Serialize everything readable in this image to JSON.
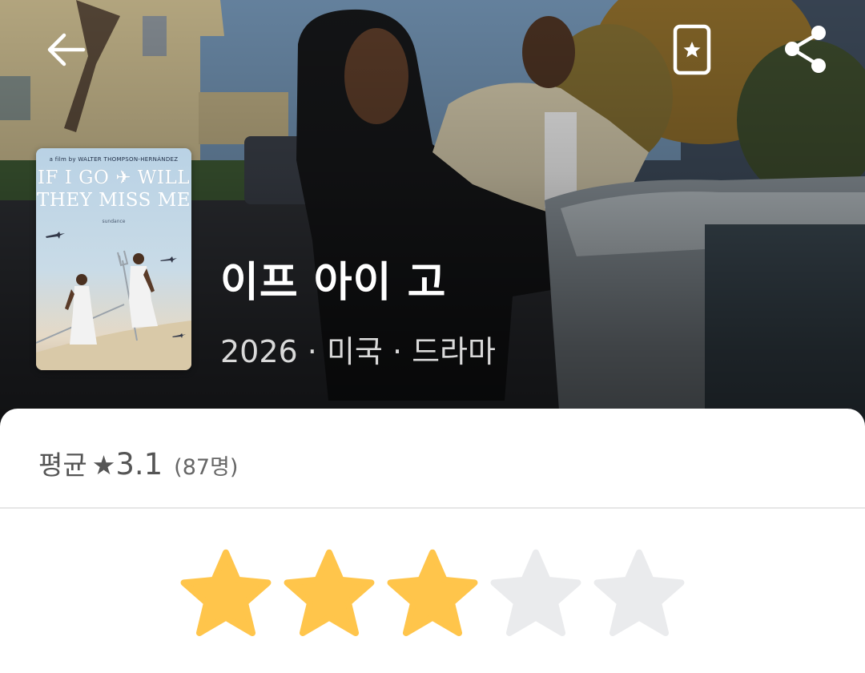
{
  "header": {
    "back_icon": "arrow-left-icon",
    "collection_icon": "star-card-icon",
    "share_icon": "share-icon"
  },
  "poster": {
    "credit": "a film by WALTER THOMPSON-HERNÁNDEZ",
    "title_line1": "IF I GO ✈ WILL",
    "title_line2": "THEY MISS ME",
    "badge": "sundance"
  },
  "movie": {
    "title": "이프 아이 고",
    "meta": "2026 · 미국 · 드라마"
  },
  "rating": {
    "average_label": "평균",
    "star_glyph": "★",
    "average_value": "3.1",
    "count": "(87명)",
    "user_rating": 3,
    "max_stars": 5,
    "filled_color": "#FFC54B",
    "empty_color": "#EAEBED"
  }
}
